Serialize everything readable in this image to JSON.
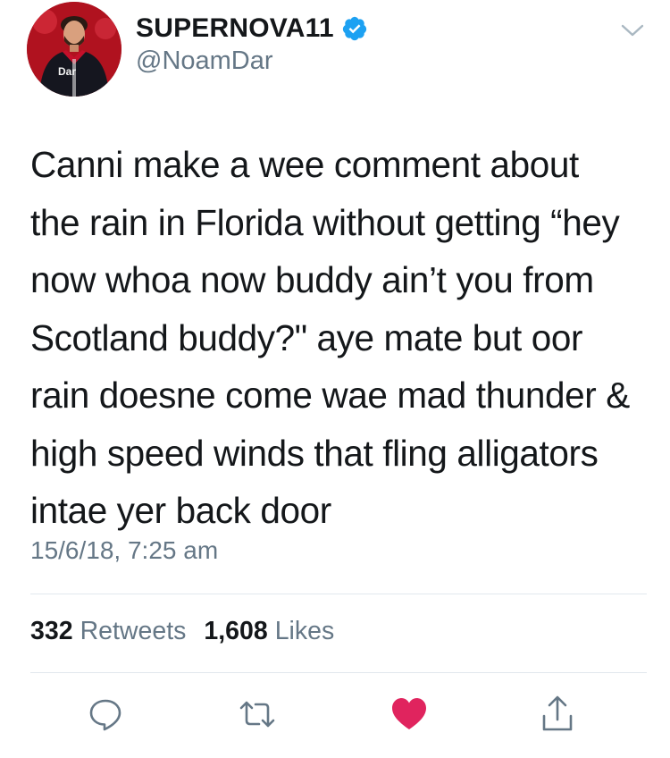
{
  "tweet": {
    "author": {
      "display_name": "SUPERNOVA11",
      "handle": "@NoamDar",
      "verified": true,
      "avatar_text": "Dar"
    },
    "text_lines": [
      "Canni make a wee comment about",
      "the rain in Florida without getting “hey",
      "now whoa now buddy ain’t you from",
      "Scotland buddy?\" aye mate but oor",
      "rain doesne come wae mad thunder &",
      "high speed winds that fling alligators",
      "intae yer back door"
    ],
    "timestamp": "15/6/18, 7:25 am",
    "stats": {
      "retweets_count": "332",
      "retweets_label": "Retweets",
      "likes_count": "1,608",
      "likes_label": "Likes"
    },
    "actions": {
      "reply_icon": "reply-icon",
      "retweet_icon": "retweet-icon",
      "like_icon": "heart-icon",
      "share_icon": "share-icon",
      "liked": true
    }
  },
  "colors": {
    "text": "#14171a",
    "secondary": "#657786",
    "verified": "#1da1f2",
    "like": "#e0245e",
    "divider": "#e1e8ed"
  }
}
